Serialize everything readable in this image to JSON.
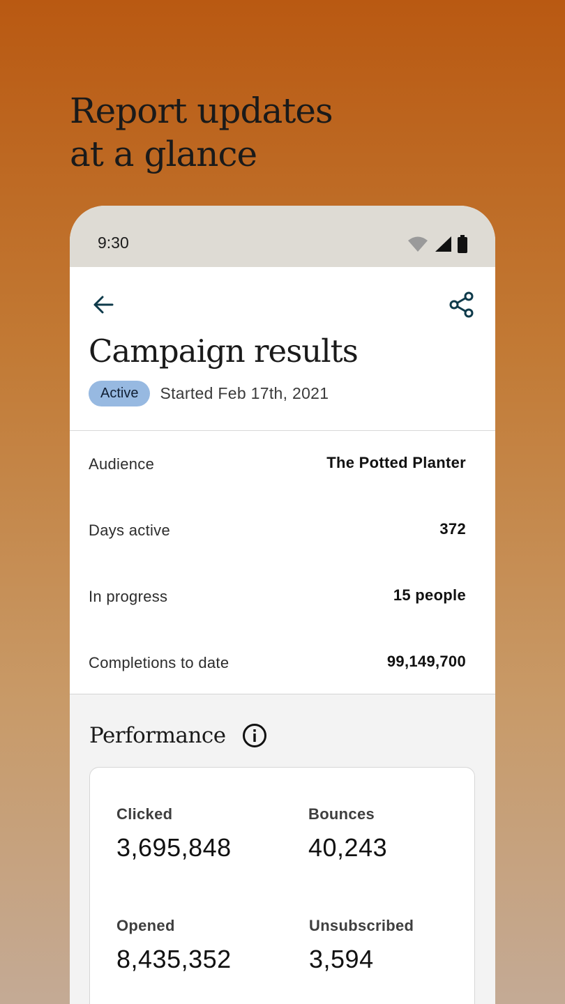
{
  "headline": {
    "line1": "Report updates",
    "line2": "at a glance"
  },
  "status_bar": {
    "time": "9:30",
    "icons": [
      "wifi-icon",
      "signal-icon",
      "battery-icon"
    ]
  },
  "app_bar": {
    "back_icon": "arrow-back-icon",
    "share_icon": "share-icon"
  },
  "campaign": {
    "title": "Campaign results",
    "status_badge": "Active",
    "started": "Started Feb 17th, 2021"
  },
  "details": [
    {
      "label": "Audience",
      "value": "The Potted Planter"
    },
    {
      "label": "Days active",
      "value": "372"
    },
    {
      "label": "In progress",
      "value": "15 people"
    },
    {
      "label": "Completions to date",
      "value": "99,149,700"
    }
  ],
  "performance": {
    "title": "Performance",
    "info_icon": "info-icon",
    "metrics": [
      {
        "label": "Clicked",
        "value": "3,695,848"
      },
      {
        "label": "Bounces",
        "value": "40,243"
      },
      {
        "label": "Opened",
        "value": "8,435,352"
      },
      {
        "label": "Unsubscribed",
        "value": "3,594"
      }
    ]
  },
  "colors": {
    "background_top": "#b95912",
    "background_bottom": "#c4aa95",
    "status_bar": "#dedbd4",
    "badge": "#97b9e1",
    "icon_accent": "#0e3a4a",
    "performance_bg": "#f3f3f3"
  }
}
